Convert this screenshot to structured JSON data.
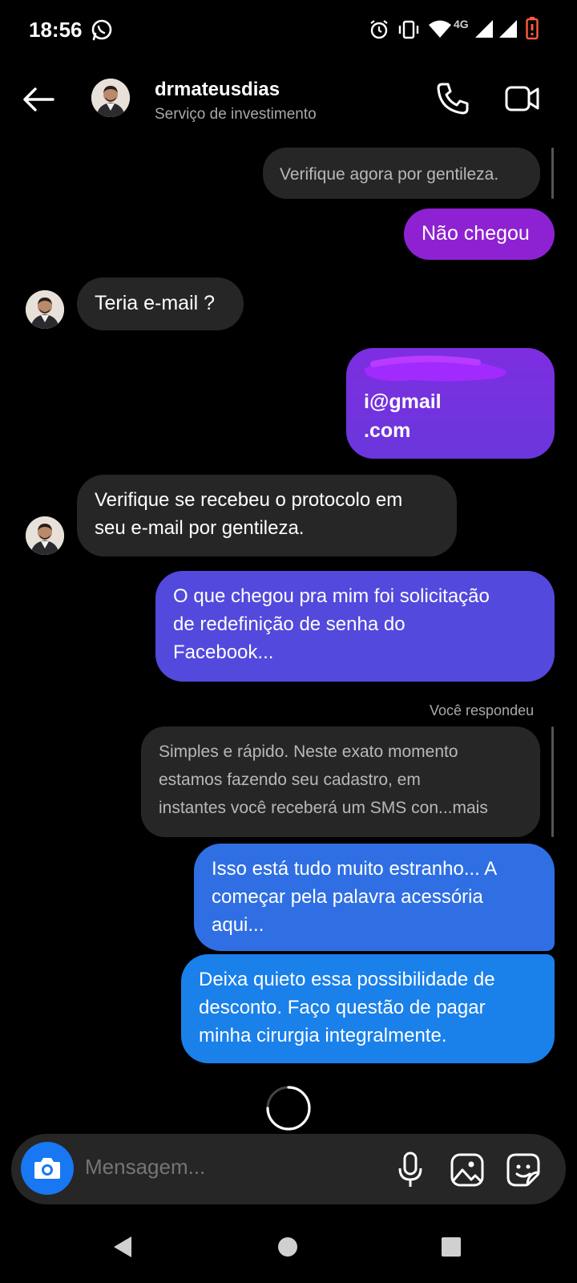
{
  "status_bar": {
    "time": "18:56",
    "network": "4G",
    "icons": [
      "whatsapp-icon",
      "alarm-icon",
      "vibrate-icon",
      "wifi-icon",
      "signal-icon",
      "battery-low-icon"
    ]
  },
  "header": {
    "username": "drmateusdias",
    "subtitle": "Serviço de investimento"
  },
  "messages": [
    {
      "from": "them",
      "text": "Verifique agora por gentileza.",
      "style": "quoted"
    },
    {
      "from": "me",
      "text": "Não chegou"
    },
    {
      "from": "them",
      "text": "Teria e-mail ?"
    },
    {
      "from": "me",
      "line1": "i@gmail",
      "line2": ".com",
      "redacted": true
    },
    {
      "from": "them",
      "line1": "Verifique se recebeu o protocolo em",
      "line2": "seu e-mail por gentileza."
    },
    {
      "from": "me",
      "line1": "O que chegou pra mim foi solicitação",
      "line2": "de redefinição de senha do",
      "line3": "Facebook..."
    },
    {
      "from": "me",
      "line1": "Isso está tudo muito estranho... A",
      "line2": "começar pela palavra acessória",
      "line3": "aqui..."
    },
    {
      "from": "me",
      "line1": "Deixa quieto essa possibilidade de",
      "line2": "desconto. Faço questão de pagar",
      "line3": "minha cirurgia integralmente."
    }
  ],
  "reply_context": {
    "label": "Você respondeu",
    "line1": "Simples e rápido. Neste exato momento",
    "line2": "estamos fazendo seu cadastro, em",
    "line3": "instantes você receberá um SMS con...mais"
  },
  "composer": {
    "placeholder": "Mensagem..."
  },
  "colors": {
    "bubble_purple": "#8e22d2",
    "bubble_violet": "#5a3fe0",
    "bubble_blue": "#2f6fe3",
    "bubble_light_blue": "#1a80ea",
    "incoming": "#262626",
    "camera_button": "#1877f2"
  }
}
